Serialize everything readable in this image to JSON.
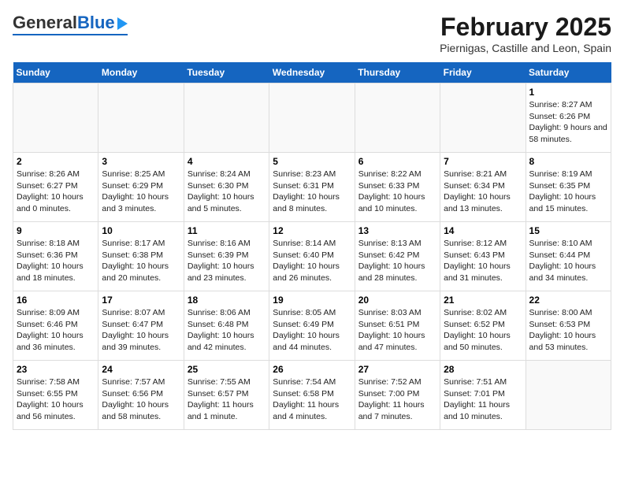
{
  "header": {
    "logo_general": "General",
    "logo_blue": "Blue",
    "title": "February 2025",
    "subtitle": "Piernigas, Castille and Leon, Spain"
  },
  "days_of_week": [
    "Sunday",
    "Monday",
    "Tuesday",
    "Wednesday",
    "Thursday",
    "Friday",
    "Saturday"
  ],
  "weeks": [
    [
      {
        "day": "",
        "info": ""
      },
      {
        "day": "",
        "info": ""
      },
      {
        "day": "",
        "info": ""
      },
      {
        "day": "",
        "info": ""
      },
      {
        "day": "",
        "info": ""
      },
      {
        "day": "",
        "info": ""
      },
      {
        "day": "1",
        "info": "Sunrise: 8:27 AM\nSunset: 6:26 PM\nDaylight: 9 hours and 58 minutes."
      }
    ],
    [
      {
        "day": "2",
        "info": "Sunrise: 8:26 AM\nSunset: 6:27 PM\nDaylight: 10 hours and 0 minutes."
      },
      {
        "day": "3",
        "info": "Sunrise: 8:25 AM\nSunset: 6:29 PM\nDaylight: 10 hours and 3 minutes."
      },
      {
        "day": "4",
        "info": "Sunrise: 8:24 AM\nSunset: 6:30 PM\nDaylight: 10 hours and 5 minutes."
      },
      {
        "day": "5",
        "info": "Sunrise: 8:23 AM\nSunset: 6:31 PM\nDaylight: 10 hours and 8 minutes."
      },
      {
        "day": "6",
        "info": "Sunrise: 8:22 AM\nSunset: 6:33 PM\nDaylight: 10 hours and 10 minutes."
      },
      {
        "day": "7",
        "info": "Sunrise: 8:21 AM\nSunset: 6:34 PM\nDaylight: 10 hours and 13 minutes."
      },
      {
        "day": "8",
        "info": "Sunrise: 8:19 AM\nSunset: 6:35 PM\nDaylight: 10 hours and 15 minutes."
      }
    ],
    [
      {
        "day": "9",
        "info": "Sunrise: 8:18 AM\nSunset: 6:36 PM\nDaylight: 10 hours and 18 minutes."
      },
      {
        "day": "10",
        "info": "Sunrise: 8:17 AM\nSunset: 6:38 PM\nDaylight: 10 hours and 20 minutes."
      },
      {
        "day": "11",
        "info": "Sunrise: 8:16 AM\nSunset: 6:39 PM\nDaylight: 10 hours and 23 minutes."
      },
      {
        "day": "12",
        "info": "Sunrise: 8:14 AM\nSunset: 6:40 PM\nDaylight: 10 hours and 26 minutes."
      },
      {
        "day": "13",
        "info": "Sunrise: 8:13 AM\nSunset: 6:42 PM\nDaylight: 10 hours and 28 minutes."
      },
      {
        "day": "14",
        "info": "Sunrise: 8:12 AM\nSunset: 6:43 PM\nDaylight: 10 hours and 31 minutes."
      },
      {
        "day": "15",
        "info": "Sunrise: 8:10 AM\nSunset: 6:44 PM\nDaylight: 10 hours and 34 minutes."
      }
    ],
    [
      {
        "day": "16",
        "info": "Sunrise: 8:09 AM\nSunset: 6:46 PM\nDaylight: 10 hours and 36 minutes."
      },
      {
        "day": "17",
        "info": "Sunrise: 8:07 AM\nSunset: 6:47 PM\nDaylight: 10 hours and 39 minutes."
      },
      {
        "day": "18",
        "info": "Sunrise: 8:06 AM\nSunset: 6:48 PM\nDaylight: 10 hours and 42 minutes."
      },
      {
        "day": "19",
        "info": "Sunrise: 8:05 AM\nSunset: 6:49 PM\nDaylight: 10 hours and 44 minutes."
      },
      {
        "day": "20",
        "info": "Sunrise: 8:03 AM\nSunset: 6:51 PM\nDaylight: 10 hours and 47 minutes."
      },
      {
        "day": "21",
        "info": "Sunrise: 8:02 AM\nSunset: 6:52 PM\nDaylight: 10 hours and 50 minutes."
      },
      {
        "day": "22",
        "info": "Sunrise: 8:00 AM\nSunset: 6:53 PM\nDaylight: 10 hours and 53 minutes."
      }
    ],
    [
      {
        "day": "23",
        "info": "Sunrise: 7:58 AM\nSunset: 6:55 PM\nDaylight: 10 hours and 56 minutes."
      },
      {
        "day": "24",
        "info": "Sunrise: 7:57 AM\nSunset: 6:56 PM\nDaylight: 10 hours and 58 minutes."
      },
      {
        "day": "25",
        "info": "Sunrise: 7:55 AM\nSunset: 6:57 PM\nDaylight: 11 hours and 1 minute."
      },
      {
        "day": "26",
        "info": "Sunrise: 7:54 AM\nSunset: 6:58 PM\nDaylight: 11 hours and 4 minutes."
      },
      {
        "day": "27",
        "info": "Sunrise: 7:52 AM\nSunset: 7:00 PM\nDaylight: 11 hours and 7 minutes."
      },
      {
        "day": "28",
        "info": "Sunrise: 7:51 AM\nSunset: 7:01 PM\nDaylight: 11 hours and 10 minutes."
      },
      {
        "day": "",
        "info": ""
      }
    ]
  ]
}
